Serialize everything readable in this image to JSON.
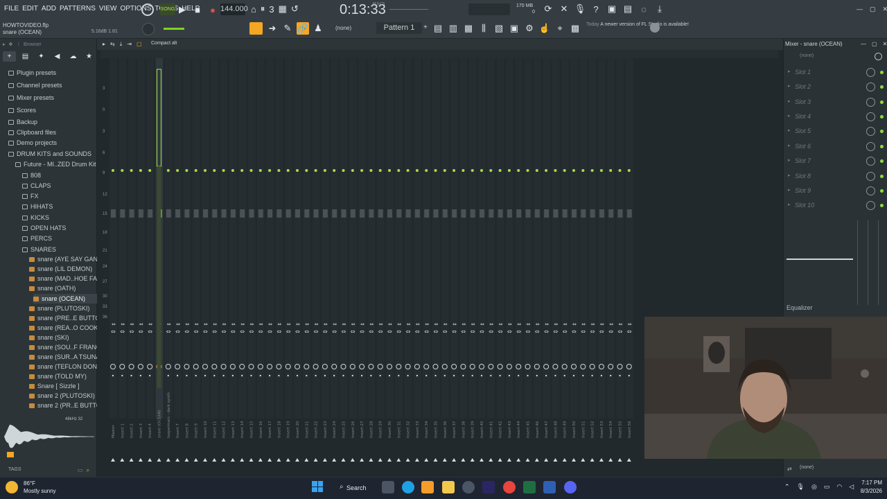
{
  "menu": [
    "FILE",
    "EDIT",
    "ADD",
    "PATTERNS",
    "VIEW",
    "OPTIONS",
    "TOOLS",
    "HELP"
  ],
  "transport": {
    "song_label": "SONG",
    "tempo": "144.000",
    "time": "0:13:33",
    "time_unit": "M:S:CS",
    "mem": "170 MB",
    "mem2": "0"
  },
  "project": {
    "file": "HOWTOVIDEO.flp",
    "selected": "snare (OCEAN)",
    "stat": "5.16dB  1.81"
  },
  "toolbar": {
    "pattern": "Pattern 1",
    "none": "(none)",
    "news_date": "Today",
    "news": "A newer version of FL Studio is available!"
  },
  "browser": {
    "title": "Browser",
    "items": [
      {
        "label": "Plugin presets",
        "depth": 0,
        "type": "folder"
      },
      {
        "label": "Channel presets",
        "depth": 0,
        "type": "folder"
      },
      {
        "label": "Mixer presets",
        "depth": 0,
        "type": "folder"
      },
      {
        "label": "Scores",
        "depth": 0,
        "type": "folder"
      },
      {
        "label": "Backup",
        "depth": 0,
        "type": "folder"
      },
      {
        "label": "Clipboard files",
        "depth": 0,
        "type": "folder"
      },
      {
        "label": "Demo projects",
        "depth": 0,
        "type": "folder"
      },
      {
        "label": "DRUM KITS  and SOUNDS",
        "depth": 0,
        "type": "folder"
      },
      {
        "label": "Future - MI..ZED Drum Kit",
        "depth": 1,
        "type": "folder"
      },
      {
        "label": "808",
        "depth": 2,
        "type": "folder"
      },
      {
        "label": "CLAPS",
        "depth": 2,
        "type": "folder"
      },
      {
        "label": "FX",
        "depth": 2,
        "type": "folder"
      },
      {
        "label": "HIHATS",
        "depth": 2,
        "type": "folder"
      },
      {
        "label": "KICKS",
        "depth": 2,
        "type": "folder"
      },
      {
        "label": "OPEN HATS",
        "depth": 2,
        "type": "folder"
      },
      {
        "label": "PERCS",
        "depth": 2,
        "type": "folder"
      },
      {
        "label": "SNARES",
        "depth": 2,
        "type": "folder"
      },
      {
        "label": "snare (AYE SAY GANG)",
        "depth": 3,
        "type": "file"
      },
      {
        "label": "snare (LIL DEMON)",
        "depth": 3,
        "type": "file"
      },
      {
        "label": "snare (MAD..HOE FAINT)",
        "depth": 3,
        "type": "file"
      },
      {
        "label": "snare (OATH)",
        "depth": 3,
        "type": "file"
      },
      {
        "label": "snare (OCEAN)",
        "depth": 3,
        "type": "file",
        "selected": true
      },
      {
        "label": "snare (PLUTOSKI)",
        "depth": 3,
        "type": "file"
      },
      {
        "label": "snare (PRE..E BUTTON)",
        "depth": 3,
        "type": "file"
      },
      {
        "label": "snare (REA..O COOK UP)",
        "depth": 3,
        "type": "file"
      },
      {
        "label": "snare (SKI)",
        "depth": 3,
        "type": "file"
      },
      {
        "label": "snare (SOU..F FRANCE)",
        "depth": 3,
        "type": "file"
      },
      {
        "label": "snare (SUR..A TSUNAMI)",
        "depth": 3,
        "type": "file"
      },
      {
        "label": "snare (TEFLON DON)",
        "depth": 3,
        "type": "file"
      },
      {
        "label": "snare (TOLD MY)",
        "depth": 3,
        "type": "file"
      },
      {
        "label": "Snare [ Sizzle ]",
        "depth": 3,
        "type": "file"
      },
      {
        "label": "snare 2 (PLUTOSKI)",
        "depth": 3,
        "type": "file"
      },
      {
        "label": "snare 2 (PR..E BUTTON)",
        "depth": 3,
        "type": "file"
      }
    ],
    "tags": "TAGS",
    "wave_info": "48kHz 32"
  },
  "mixer": {
    "mode": "Compact alt",
    "db_ticks": [
      "3",
      "0",
      "3",
      "6",
      "9",
      "12",
      "15",
      "18",
      "21",
      "24",
      "27",
      "30",
      "33",
      "36"
    ],
    "tracks": [
      "Master",
      "Insert 1",
      "Insert 2",
      "Insert 3",
      "Insert 4",
      "snare (OCEAN)",
      "loopermain - dark synth",
      "Insert 7",
      "Insert 8",
      "Insert 9",
      "Insert 10",
      "Insert 11",
      "Insert 12",
      "Insert 13",
      "Insert 14",
      "Insert 15",
      "Insert 16",
      "Insert 17",
      "Insert 18",
      "Insert 19",
      "Insert 20",
      "Insert 21",
      "Insert 22",
      "Insert 23",
      "Insert 24",
      "Insert 25",
      "Insert 26",
      "Insert 27",
      "Insert 28",
      "Insert 29",
      "Insert 30",
      "Insert 31",
      "Insert 32",
      "Insert 33",
      "Insert 34",
      "Insert 35",
      "Insert 36",
      "Insert 37",
      "Insert 38",
      "Insert 39",
      "Insert 40",
      "Insert 41",
      "Insert 42",
      "Insert 43",
      "Insert 44",
      "Insert 45",
      "Insert 46",
      "Insert 47",
      "Insert 48",
      "Insert 49",
      "Insert 50",
      "Insert 51",
      "Insert 52",
      "Insert 53",
      "Insert 54",
      "Insert 55",
      "Insert 56"
    ]
  },
  "side_mixer": {
    "title": "Mixer - snare (OCEAN)",
    "input": "(none)",
    "slots": [
      "Slot 1",
      "Slot 2",
      "Slot 3",
      "Slot 4",
      "Slot 5",
      "Slot 6",
      "Slot 7",
      "Slot 8",
      "Slot 9",
      "Slot 10"
    ],
    "eq_label": "Equalizer",
    "output": "(none)"
  },
  "taskbar": {
    "temp": "86°F",
    "weather": "Mostly sunny",
    "search": "Search",
    "time": "7:17 PM",
    "date": "8/3/2026"
  },
  "colors": {
    "accent": "#9ee64a",
    "bg": "#2a3136",
    "orange": "#f5a623"
  }
}
